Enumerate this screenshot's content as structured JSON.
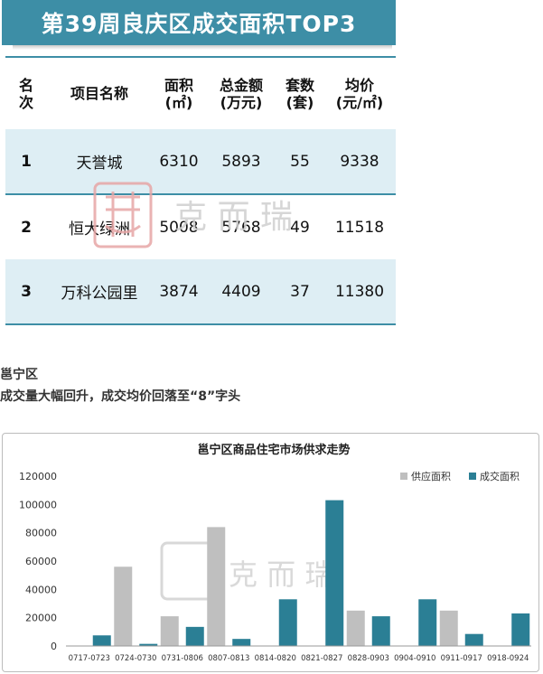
{
  "banner": {
    "title": "第39周良庆区成交面积TOP3"
  },
  "table": {
    "headers": [
      [
        "名",
        "次"
      ],
      [
        "项目名称"
      ],
      [
        "面积",
        "(㎡)"
      ],
      [
        "总金额",
        "(万元)"
      ],
      [
        "套数",
        "(套)"
      ],
      [
        "均价",
        "(元/㎡)"
      ]
    ],
    "rows": [
      [
        "1",
        "天誉城",
        "6310",
        "5893",
        "55",
        "9338"
      ],
      [
        "2",
        "恒大绿洲",
        "5008",
        "5768",
        "49",
        "11518"
      ],
      [
        "3",
        "万科公园里",
        "3874",
        "4409",
        "37",
        "11380"
      ]
    ]
  },
  "watermark": {
    "text": "克 而 瑞"
  },
  "section": {
    "title": "邕宁区",
    "subtitle": "成交量大幅回升，成交均价回落至“8”字头"
  },
  "colors": {
    "supply": "#bfbfbf",
    "deal": "#2b7f95",
    "accent": "#3d8ea6"
  },
  "chart_data": {
    "type": "bar",
    "title": "邕宁区商品住宅市场供求走势",
    "categories": [
      "0717-0723",
      "0724-0730",
      "0731-0806",
      "0807-0813",
      "0814-0820",
      "0821-0827",
      "0828-0903",
      "0904-0910",
      "0911-0917",
      "0918-0924"
    ],
    "series": [
      {
        "name": "供应面积",
        "values": [
          0,
          56000,
          21000,
          84000,
          0,
          0,
          25000,
          0,
          25000,
          0
        ]
      },
      {
        "name": "成交面积",
        "values": [
          7500,
          1500,
          13500,
          5000,
          33000,
          103000,
          21000,
          33000,
          8500,
          23000
        ]
      }
    ],
    "ylim": [
      0,
      120000
    ],
    "yticks": [
      "0",
      "20000",
      "40000",
      "60000",
      "80000",
      "100000",
      "120000"
    ],
    "legend": "top-right",
    "grid": false
  }
}
